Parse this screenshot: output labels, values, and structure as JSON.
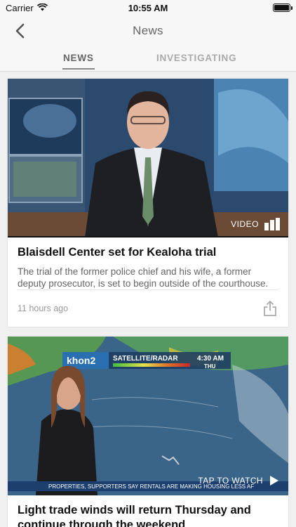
{
  "status_bar": {
    "carrier": "Carrier",
    "time": "10:55 AM"
  },
  "nav": {
    "title": "News"
  },
  "tabs": [
    {
      "label": "NEWS",
      "active": true
    },
    {
      "label": "INVESTIGATING",
      "active": false
    }
  ],
  "articles": [
    {
      "headline": "Blaisdell Center set for Kealoha trial",
      "summary": "The trial of the former police chief and his wife, a former deputy prosecutor, is set to begin outside of the courthouse.",
      "timestamp": "11 hours ago",
      "media_badge": "VIDEO",
      "thumbnail": "news-anchor-video-thumbnail"
    },
    {
      "headline": "Light trade winds will return Thursday and continue through the weekend",
      "media_badge": "TAP TO WATCH",
      "thumbnail": "weather-radar-video-thumbnail",
      "ticker_text": "PROPERTIES, SUPPORTERS SAY RENTALS ARE MAKING HOUSING LESS AF",
      "radar_header": "SATELLITE/RADAR",
      "radar_time": "4:30 AM",
      "radar_day": "THU"
    }
  ],
  "colors": {
    "background": "#f0f0f0",
    "bar": "#f7f7f7",
    "tab_active": "#666666",
    "tab_inactive": "#aaaaaa"
  }
}
